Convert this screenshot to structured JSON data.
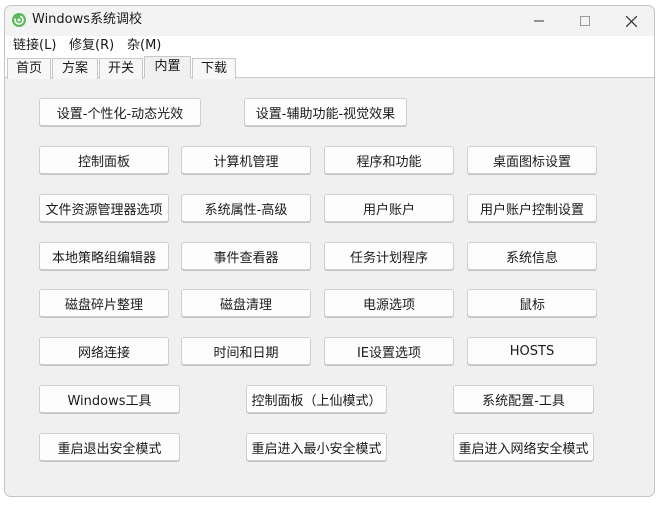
{
  "window": {
    "title": "Windows系统调校",
    "controls": {
      "minimize": "—",
      "maximize": "☐",
      "close": "✕"
    }
  },
  "menu": [
    "链接(L)",
    "修复(R)",
    "杂(M)"
  ],
  "tabs": [
    "首页",
    "方案",
    "开关",
    "内置",
    "下载"
  ],
  "active_tab": "内置",
  "buttons": {
    "row0": [
      "设置-个性化-动态光效",
      "设置-辅助功能-视觉效果"
    ],
    "grid": [
      [
        "控制面板",
        "计算机管理",
        "程序和功能",
        "桌面图标设置"
      ],
      [
        "文件资源管理器选项",
        "系统属性-高级",
        "用户账户",
        "用户账户控制设置"
      ],
      [
        "本地策略组编辑器",
        "事件查看器",
        "任务计划程序",
        "系统信息"
      ],
      [
        "磁盘碎片整理",
        "磁盘清理",
        "电源选项",
        "鼠标"
      ],
      [
        "网络连接",
        "时间和日期",
        "IE设置选项",
        "HOSTS"
      ]
    ],
    "row6": [
      "Windows工具",
      "控制面板（上仙模式）",
      "系统配置-工具"
    ],
    "row7": [
      "重启退出安全模式",
      "重启进入最小安全模式",
      "重启进入网络安全模式"
    ]
  },
  "colors": {
    "icon_green": "#5cb85c",
    "window_bg": "#f0f0f0"
  }
}
